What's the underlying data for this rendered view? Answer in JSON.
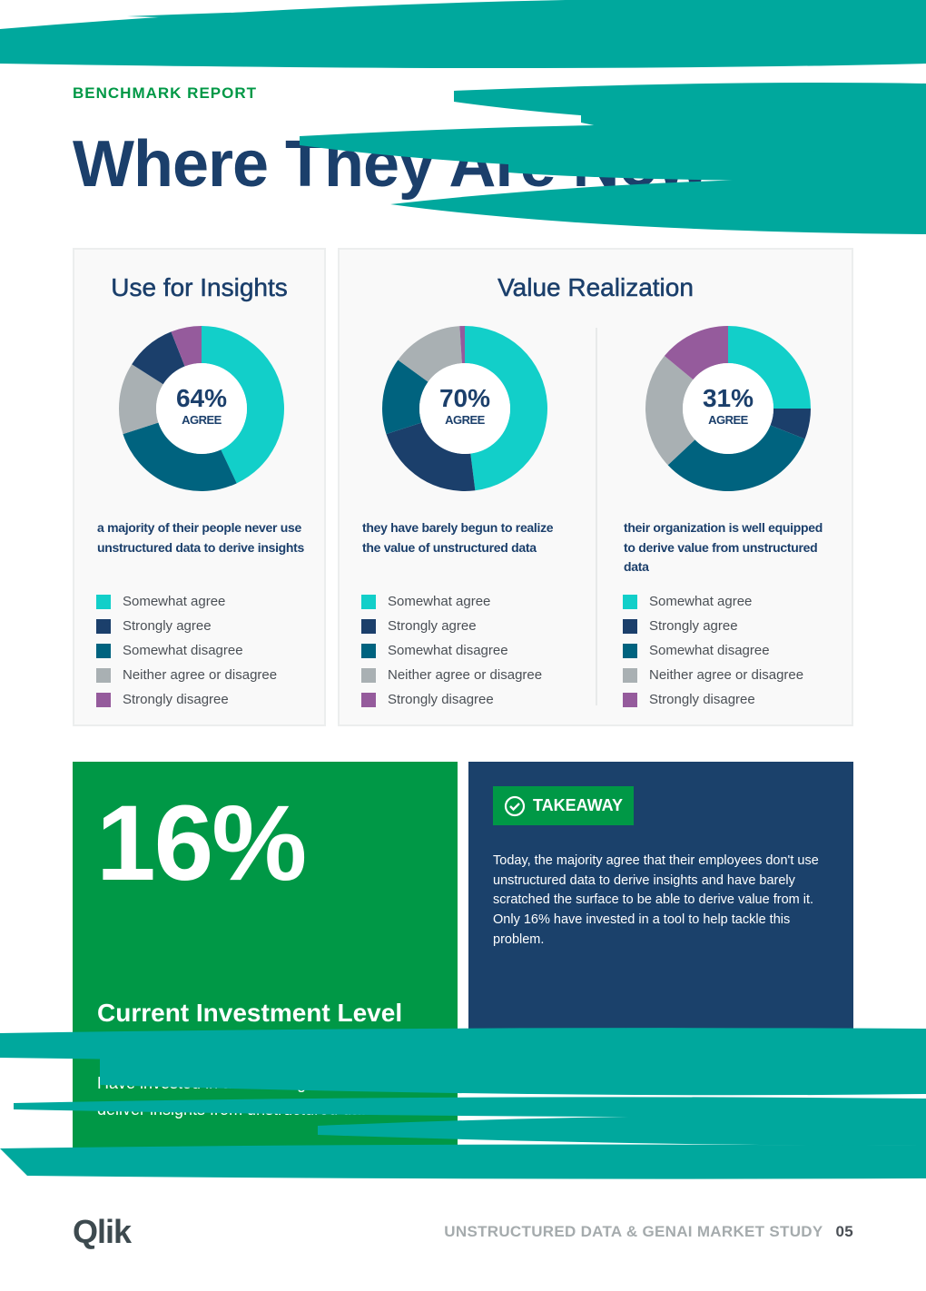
{
  "header": {
    "kicker": "BENCHMARK REPORT",
    "title": "Where They Are Now"
  },
  "colors": {
    "somewhat_agree": "#12cfc9",
    "strongly_agree": "#1b3f6b",
    "somewhat_disagree": "#00637f",
    "neither": "#a9b0b3",
    "strongly_disagree": "#955b9c",
    "green": "#009846",
    "navy": "#1b416b",
    "streak": "#00a89d"
  },
  "legend": [
    "Somewhat agree",
    "Strongly agree",
    "Somewhat disagree",
    "Neither agree or disagree",
    "Strongly disagree"
  ],
  "cards": [
    {
      "title": "Use for Insights"
    },
    {
      "title": "Value Realization"
    }
  ],
  "chart_data": [
    {
      "type": "pie",
      "donut": true,
      "center_value": "64%",
      "center_label": "AGREE",
      "description": "a majority of their people never use unstructured data to derive insights",
      "slices": [
        {
          "name": "Somewhat agree",
          "value": 43
        },
        {
          "name": "Somewhat disagree",
          "value": 27
        },
        {
          "name": "Neither agree or disagree",
          "value": 14
        },
        {
          "name": "Strongly agree",
          "value": 10
        },
        {
          "name": "Strongly disagree",
          "value": 6
        }
      ]
    },
    {
      "type": "pie",
      "donut": true,
      "center_value": "70%",
      "center_label": "AGREE",
      "description": "they have barely begun to realize the value of unstructured data",
      "slices": [
        {
          "name": "Somewhat agree",
          "value": 48
        },
        {
          "name": "Strongly agree",
          "value": 22
        },
        {
          "name": "Somewhat disagree",
          "value": 15
        },
        {
          "name": "Neither agree or disagree",
          "value": 14
        },
        {
          "name": "Strongly disagree",
          "value": 1
        }
      ]
    },
    {
      "type": "pie",
      "donut": true,
      "center_value": "31%",
      "center_label": "AGREE",
      "description": "their organization is well equipped to derive value from unstructured data",
      "slices": [
        {
          "name": "Somewhat agree",
          "value": 25
        },
        {
          "name": "Strongly agree",
          "value": 6
        },
        {
          "name": "Somewhat disagree",
          "value": 32
        },
        {
          "name": "Neither agree or disagree",
          "value": 23
        },
        {
          "name": "Strongly disagree",
          "value": 14
        }
      ]
    }
  ],
  "stat": {
    "value": "16%",
    "label": "Current Investment Level",
    "sub": "Have invested in a tool designed to deliver insights from unstructured data"
  },
  "takeaway": {
    "badge": "TAKEAWAY",
    "text": "Today, the majority agree that their employees don't use unstructured data to derive insights and have barely scratched the surface to be able to derive value from it. Only 16% have invested in a tool to help tackle this problem."
  },
  "footer": {
    "logo": "Qlik",
    "study": "UNSTRUCTURED DATA & GENAI MARKET STUDY",
    "page": "05"
  }
}
